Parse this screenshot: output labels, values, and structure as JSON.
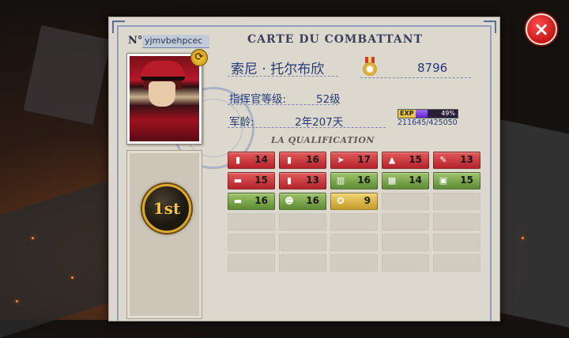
{
  "card": {
    "number_label": "N°",
    "player_id": "yjmvbehpcec",
    "title": "CARTE DU COMBATTANT",
    "name": "索尼 · 托尔布欣",
    "score": "8796",
    "commander_level_label": "指挥官等级:",
    "commander_level_value": "52级",
    "service_label": "军龄:",
    "service_value": "2年207天",
    "exp_tag": "EXP",
    "exp_percent": "49%",
    "exp_fraction": 0.49,
    "exp_numbers": "211645/425050",
    "qualification_title": "LA QUALIFICATION",
    "rank_badge": "1st"
  },
  "qualifications": [
    {
      "icon": "bullet-icon",
      "level": "14",
      "color": "red"
    },
    {
      "icon": "shell-icon",
      "level": "16",
      "color": "red"
    },
    {
      "icon": "rocket-icon",
      "level": "17",
      "color": "red"
    },
    {
      "icon": "ammo-icon",
      "level": "15",
      "color": "red"
    },
    {
      "icon": "wrench-icon",
      "level": "13",
      "color": "red"
    },
    {
      "icon": "pipe-icon",
      "level": "15",
      "color": "red"
    },
    {
      "icon": "cartridge-icon",
      "level": "13",
      "color": "red"
    },
    {
      "icon": "book-icon",
      "level": "16",
      "color": "green"
    },
    {
      "icon": "map-icon",
      "level": "14",
      "color": "green"
    },
    {
      "icon": "crate-icon",
      "level": "15",
      "color": "green"
    },
    {
      "icon": "tank-icon",
      "level": "16",
      "color": "green"
    },
    {
      "icon": "soldier-icon",
      "level": "16",
      "color": "green"
    },
    {
      "icon": "medal-icon",
      "level": "9",
      "color": "gold"
    }
  ],
  "colors": {
    "accent_text": "#243a7a",
    "close_button": "#c51616"
  },
  "close_icon": "×"
}
